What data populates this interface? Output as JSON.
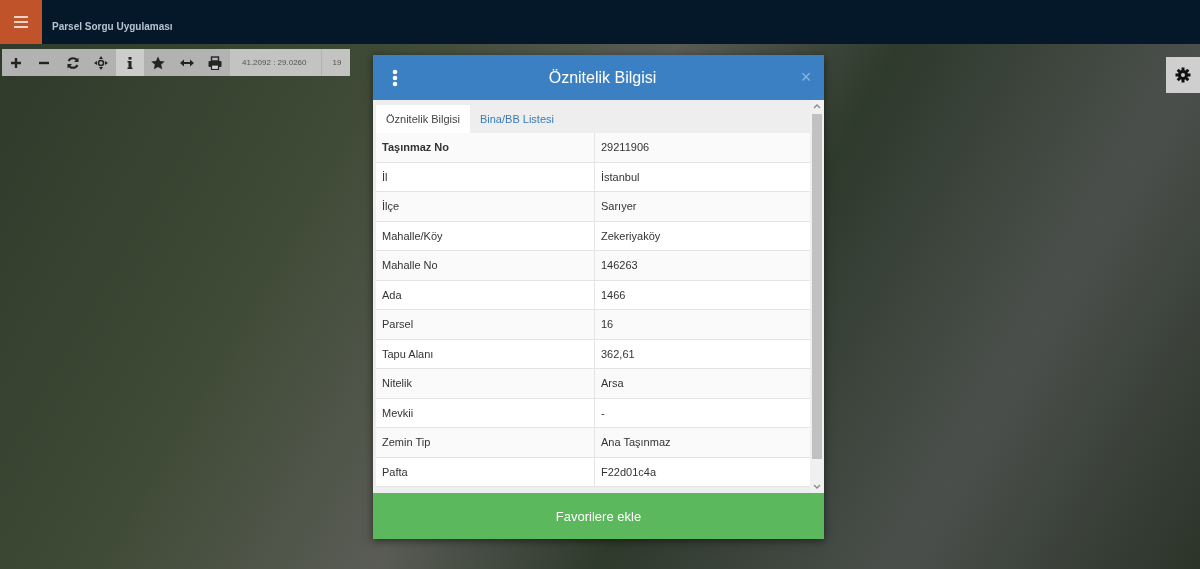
{
  "header": {
    "subtitle": "Parsel Sorgu Uygulaması"
  },
  "toolbar": {
    "tools": [
      {
        "kind": "zoom-in",
        "selected": false
      },
      {
        "kind": "zoom-out",
        "selected": false
      },
      {
        "kind": "refresh",
        "selected": false
      },
      {
        "kind": "locate",
        "selected": false
      },
      {
        "kind": "info",
        "selected": true
      },
      {
        "kind": "favorite",
        "selected": false
      },
      {
        "kind": "measure",
        "selected": false
      },
      {
        "kind": "print",
        "selected": false
      }
    ],
    "coordinates": "41.2092 : 29.0260",
    "zoom": "19"
  },
  "dialog": {
    "title": "Öznitelik Bilgisi",
    "close": "×",
    "tabs": [
      {
        "label": "Öznitelik Bilgisi",
        "selected": true
      },
      {
        "label": "Bina/BB Listesi",
        "selected": false
      }
    ],
    "rows": [
      {
        "label": "Taşınmaz No",
        "value": "29211906",
        "bold": true
      },
      {
        "label": "İl",
        "value": "İstanbul",
        "bold": false
      },
      {
        "label": "İlçe",
        "value": "Sarıyer",
        "bold": false
      },
      {
        "label": "Mahalle/Köy",
        "value": "Zekeriyaköy",
        "bold": false
      },
      {
        "label": "Mahalle No",
        "value": "146263",
        "bold": false
      },
      {
        "label": "Ada",
        "value": "1466",
        "bold": false
      },
      {
        "label": "Parsel",
        "value": "16",
        "bold": false
      },
      {
        "label": "Tapu Alanı",
        "value": "362,61",
        "bold": false
      },
      {
        "label": "Nitelik",
        "value": "Arsa",
        "bold": false
      },
      {
        "label": "Mevkii",
        "value": "-",
        "bold": false
      },
      {
        "label": "Zemin Tip",
        "value": "Ana Taşınmaz",
        "bold": false
      },
      {
        "label": "Pafta",
        "value": "F22d01c4a",
        "bold": false
      }
    ],
    "action": "Favorilere ekle"
  }
}
